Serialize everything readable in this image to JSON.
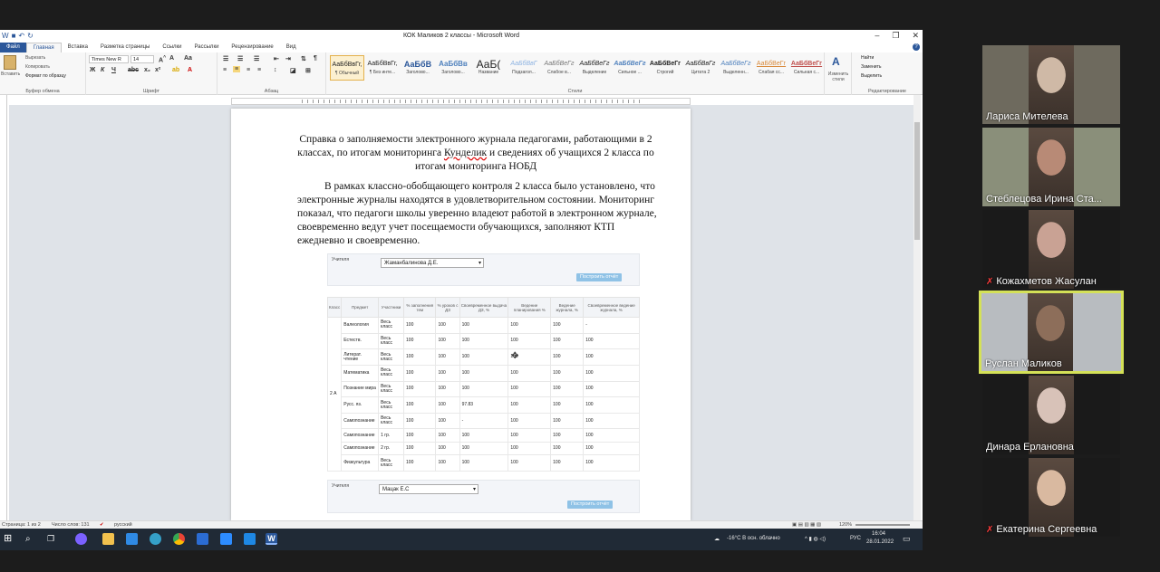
{
  "window": {
    "title": "КОК Маликов 2 классы - Microsoft Word"
  },
  "tabs": [
    "Файл",
    "Главная",
    "Вставка",
    "Разметка страницы",
    "Ссылки",
    "Рассылки",
    "Рецензирование",
    "Вид"
  ],
  "ribbon": {
    "clipboard": {
      "paste": "Вставить",
      "cut": "Вырезать",
      "copy": "Копировать",
      "format": "Формат по образцу",
      "label": "Буфер обмена"
    },
    "font": {
      "name": "Times New R",
      "size": "14",
      "label": "Шрифт"
    },
    "paragraph": {
      "label": "Абзац"
    },
    "styles": {
      "label": "Стили",
      "items": [
        {
          "preview": "АаБбВвГг,",
          "name": "¶ Обычный"
        },
        {
          "preview": "АаБбВвГг,",
          "name": "¶ Без инте..."
        },
        {
          "preview": "АаБбВ",
          "name": "Заголово..."
        },
        {
          "preview": "АаБбВв",
          "name": "Заголово..."
        },
        {
          "preview": "АаБ(",
          "name": "Название"
        },
        {
          "preview": "АаБбВвГ",
          "name": "Подзагол..."
        },
        {
          "preview": "АаБбВеГг",
          "name": "Слабое в..."
        },
        {
          "preview": "АаБбВеГг",
          "name": "Выделение"
        },
        {
          "preview": "АаБбВеГг",
          "name": "Сильное ..."
        },
        {
          "preview": "АаБбВеГг",
          "name": "Строгий"
        },
        {
          "preview": "АаБбВвГг",
          "name": "Цитата 2"
        },
        {
          "preview": "АаБбВеГг",
          "name": "Выделенн..."
        },
        {
          "preview": "АаБбВеГг",
          "name": "Слабая сс..."
        },
        {
          "preview": "АаБбВеГг",
          "name": "Сильная с..."
        }
      ],
      "change": "Изменить стили"
    },
    "editing": {
      "find": "Найти",
      "replace": "Заменить",
      "select": "Выделить",
      "label": "Редактирование"
    }
  },
  "document": {
    "title_pre": "Справка о заполняемости электронного журнала педагогами, работающими в 2 классах, по итогам мониторинга ",
    "title_spell": "Кунделик",
    "title_post": " и сведениях об учащихся 2 класса по итогам мониторинга НОБД",
    "body": "В рамках классно-обобщающего контроля 2 класса было установлено, что электронные журналы находятся в удовлетворительном состоянии. Мониторинг показал, что педагоги школы уверенно владеют работой в электронном журнале, своевременно ведут учет посещаемости обучающихся, заполняют КТП ежедневно и своевременно."
  },
  "report1": {
    "teacher_label": "Учителя",
    "teacher": "Жаманбалинова Д.Е.",
    "button": "Построить отчёт"
  },
  "report_table": {
    "headers": [
      "Класс",
      "Предмет",
      "Участники",
      "% заполнения тем",
      "% уроков с ДЗ",
      "Своевременное выдача ДЗ, %",
      "Ведение планирования %",
      "Ведение журнала, %",
      "Своевременное ведение журнала, %"
    ],
    "class": "2 А",
    "rows": [
      [
        "Валеология",
        "Весь класс",
        "100",
        "100",
        "100",
        "100",
        "100",
        "-"
      ],
      [
        "Естеств.",
        "Весь класс",
        "100",
        "100",
        "100",
        "100",
        "100",
        "100"
      ],
      [
        "Литерат. чтение",
        "Весь класс",
        "100",
        "100",
        "100",
        "100",
        "100",
        "100"
      ],
      [
        "Математика",
        "Весь класс",
        "100",
        "100",
        "100",
        "100",
        "100",
        "100"
      ],
      [
        "Познание мира",
        "Весь класс",
        "100",
        "100",
        "100",
        "100",
        "100",
        "100"
      ],
      [
        "Русс. яз.",
        "Весь класс",
        "100",
        "100",
        "97.83",
        "100",
        "100",
        "100"
      ],
      [
        "Самопознание",
        "Весь класс",
        "100",
        "100",
        "-",
        "100",
        "100",
        "100"
      ],
      [
        "Самопознание",
        "1 гр.",
        "100",
        "100",
        "100",
        "100",
        "100",
        "100"
      ],
      [
        "Самопознание",
        "2 гр.",
        "100",
        "100",
        "100",
        "100",
        "100",
        "100"
      ],
      [
        "Физкультура",
        "Весь класс",
        "100",
        "100",
        "100",
        "100",
        "100",
        "100"
      ]
    ]
  },
  "report2": {
    "teacher_label": "Учителя",
    "teacher": "Мацак Е.С",
    "button": "Построить отчёт"
  },
  "statusbar": {
    "page": "Страница: 1 из 2",
    "words": "Число слов: 131",
    "lang": "русский",
    "zoom": "120%"
  },
  "taskbar": {
    "weather": "-16°C  В осн. облачно",
    "lang": "РУС",
    "time": "16:04",
    "date": "28.01.2022"
  },
  "participants": [
    {
      "name": "Лариса Мителева",
      "muted": false,
      "speaking": false,
      "bg": "#6e6a5e",
      "face": "#cfb9a6"
    },
    {
      "name": "Стеблецова Ирина Ста...",
      "muted": false,
      "speaking": false,
      "bg": "#8a8f7a",
      "face": "#b88a76"
    },
    {
      "name": "Кожахметов Жасулан",
      "muted": true,
      "speaking": false,
      "bg": "#1a1a1a",
      "face": "#c9a294"
    },
    {
      "name": "Руслан Маликов",
      "muted": false,
      "speaking": true,
      "bg": "#b8bcc0",
      "face": "#8d6e5a"
    },
    {
      "name": "Динара Ерлановна",
      "muted": false,
      "speaking": false,
      "bg": "#1a1a1a",
      "face": "#d8c2b8"
    },
    {
      "name": "Екатерина Сергеевна",
      "muted": true,
      "speaking": false,
      "bg": "#1a1a1a",
      "face": "#d9b9a0"
    }
  ]
}
